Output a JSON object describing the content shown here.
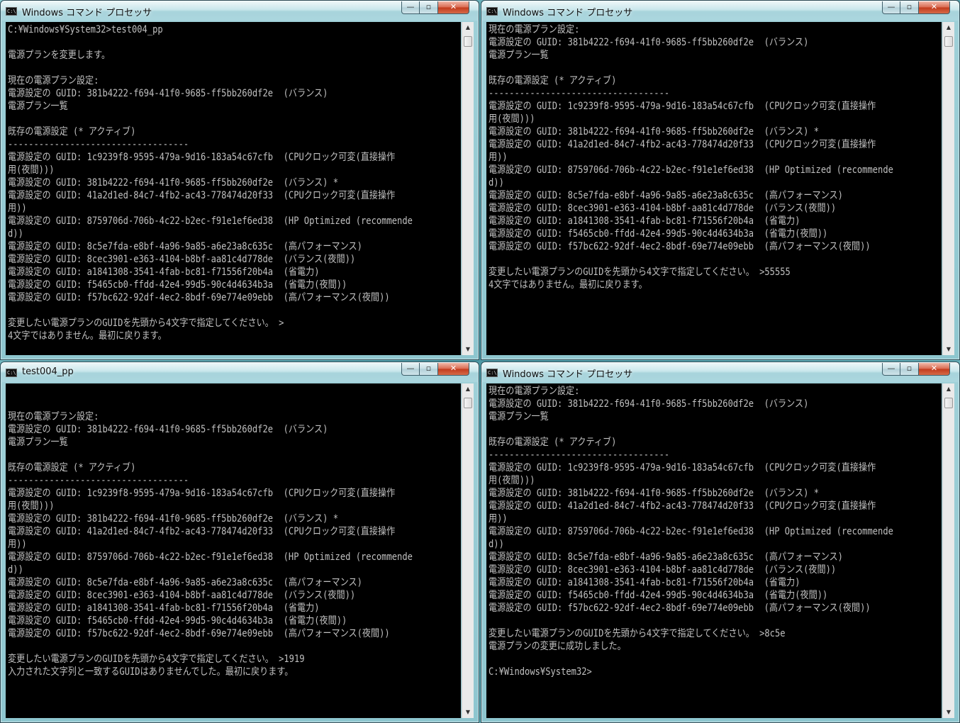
{
  "windows": [
    {
      "title": "Windows コマンド プロセッサ",
      "controls": {
        "minimize": "—",
        "maximize": "▫",
        "close": "✕"
      },
      "lines": [
        "C:¥Windows¥System32>test004_pp",
        "",
        "電源プランを変更します。",
        "",
        "現在の電源プラン設定:",
        "電源設定の GUID: 381b4222-f694-41f0-9685-ff5bb260df2e  (バランス)",
        "電源プラン一覧",
        "",
        "既存の電源設定 (* アクティブ)",
        "-----------------------------------",
        "電源設定の GUID: 1c9239f8-9595-479a-9d16-183a54c67cfb  (CPUクロック可変(直接操作",
        "用(夜間)))",
        "電源設定の GUID: 381b4222-f694-41f0-9685-ff5bb260df2e  (バランス) *",
        "電源設定の GUID: 41a2d1ed-84c7-4fb2-ac43-778474d20f33  (CPUクロック可変(直接操作",
        "用))",
        "電源設定の GUID: 8759706d-706b-4c22-b2ec-f91e1ef6ed38  (HP Optimized (recommende",
        "d))",
        "電源設定の GUID: 8c5e7fda-e8bf-4a96-9a85-a6e23a8c635c  (高パフォーマンス)",
        "電源設定の GUID: 8cec3901-e363-4104-b8bf-aa81c4d778de  (バランス(夜間))",
        "電源設定の GUID: a1841308-3541-4fab-bc81-f71556f20b4a  (省電力)",
        "電源設定の GUID: f5465cb0-ffdd-42e4-99d5-90c4d4634b3a  (省電力(夜間))",
        "電源設定の GUID: f57bc622-92df-4ec2-8bdf-69e774e09ebb  (高パフォーマンス(夜間))",
        "",
        "変更したい電源プランのGUIDを先頭から4文字で指定してください。 >",
        "4文字ではありません。最初に戻ります。"
      ]
    },
    {
      "title": "Windows コマンド プロセッサ",
      "controls": {
        "minimize": "—",
        "maximize": "▫",
        "close": "✕"
      },
      "lines": [
        "現在の電源プラン設定:",
        "電源設定の GUID: 381b4222-f694-41f0-9685-ff5bb260df2e  (バランス)",
        "電源プラン一覧",
        "",
        "既存の電源設定 (* アクティブ)",
        "-----------------------------------",
        "電源設定の GUID: 1c9239f8-9595-479a-9d16-183a54c67cfb  (CPUクロック可変(直接操作",
        "用(夜間)))",
        "電源設定の GUID: 381b4222-f694-41f0-9685-ff5bb260df2e  (バランス) *",
        "電源設定の GUID: 41a2d1ed-84c7-4fb2-ac43-778474d20f33  (CPUクロック可変(直接操作",
        "用))",
        "電源設定の GUID: 8759706d-706b-4c22-b2ec-f91e1ef6ed38  (HP Optimized (recommende",
        "d))",
        "電源設定の GUID: 8c5e7fda-e8bf-4a96-9a85-a6e23a8c635c  (高パフォーマンス)",
        "電源設定の GUID: 8cec3901-e363-4104-b8bf-aa81c4d778de  (バランス(夜間))",
        "電源設定の GUID: a1841308-3541-4fab-bc81-f71556f20b4a  (省電力)",
        "電源設定の GUID: f5465cb0-ffdd-42e4-99d5-90c4d4634b3a  (省電力(夜間))",
        "電源設定の GUID: f57bc622-92df-4ec2-8bdf-69e774e09ebb  (高パフォーマンス(夜間))",
        "",
        "変更したい電源プランのGUIDを先頭から4文字で指定してください。 >55555",
        "4文字ではありません。最初に戻ります。"
      ]
    },
    {
      "title": "test004_pp",
      "controls": {
        "minimize": "—",
        "maximize": "▫",
        "close": "✕"
      },
      "lines": [
        "",
        "",
        "現在の電源プラン設定:",
        "電源設定の GUID: 381b4222-f694-41f0-9685-ff5bb260df2e  (バランス)",
        "電源プラン一覧",
        "",
        "既存の電源設定 (* アクティブ)",
        "-----------------------------------",
        "電源設定の GUID: 1c9239f8-9595-479a-9d16-183a54c67cfb  (CPUクロック可変(直接操作",
        "用(夜間)))",
        "電源設定の GUID: 381b4222-f694-41f0-9685-ff5bb260df2e  (バランス) *",
        "電源設定の GUID: 41a2d1ed-84c7-4fb2-ac43-778474d20f33  (CPUクロック可変(直接操作",
        "用))",
        "電源設定の GUID: 8759706d-706b-4c22-b2ec-f91e1ef6ed38  (HP Optimized (recommende",
        "d))",
        "電源設定の GUID: 8c5e7fda-e8bf-4a96-9a85-a6e23a8c635c  (高パフォーマンス)",
        "電源設定の GUID: 8cec3901-e363-4104-b8bf-aa81c4d778de  (バランス(夜間))",
        "電源設定の GUID: a1841308-3541-4fab-bc81-f71556f20b4a  (省電力)",
        "電源設定の GUID: f5465cb0-ffdd-42e4-99d5-90c4d4634b3a  (省電力(夜間))",
        "電源設定の GUID: f57bc622-92df-4ec2-8bdf-69e774e09ebb  (高パフォーマンス(夜間))",
        "",
        "変更したい電源プランのGUIDを先頭から4文字で指定してください。 >1919",
        "入力された文字列と一致するGUIDはありませんでした。最初に戻ります。"
      ]
    },
    {
      "title": "Windows コマンド プロセッサ",
      "controls": {
        "minimize": "—",
        "maximize": "▫",
        "close": "✕"
      },
      "lines": [
        "現在の電源プラン設定:",
        "電源設定の GUID: 381b4222-f694-41f0-9685-ff5bb260df2e  (バランス)",
        "電源プラン一覧",
        "",
        "既存の電源設定 (* アクティブ)",
        "-----------------------------------",
        "電源設定の GUID: 1c9239f8-9595-479a-9d16-183a54c67cfb  (CPUクロック可変(直接操作",
        "用(夜間)))",
        "電源設定の GUID: 381b4222-f694-41f0-9685-ff5bb260df2e  (バランス) *",
        "電源設定の GUID: 41a2d1ed-84c7-4fb2-ac43-778474d20f33  (CPUクロック可変(直接操作",
        "用))",
        "電源設定の GUID: 8759706d-706b-4c22-b2ec-f91e1ef6ed38  (HP Optimized (recommende",
        "d))",
        "電源設定の GUID: 8c5e7fda-e8bf-4a96-9a85-a6e23a8c635c  (高パフォーマンス)",
        "電源設定の GUID: 8cec3901-e363-4104-b8bf-aa81c4d778de  (バランス(夜間))",
        "電源設定の GUID: a1841308-3541-4fab-bc81-f71556f20b4a  (省電力)",
        "電源設定の GUID: f5465cb0-ffdd-42e4-99d5-90c4d4634b3a  (省電力(夜間))",
        "電源設定の GUID: f57bc622-92df-4ec2-8bdf-69e774e09ebb  (高パフォーマンス(夜間))",
        "",
        "変更したい電源プランのGUIDを先頭から4文字で指定してください。 >8c5e",
        "電源プランの変更に成功しました。",
        "",
        "C:¥Windows¥System32>"
      ]
    }
  ],
  "theme": {
    "console_bg": "#000000",
    "console_fg": "#c0c0c0",
    "close_button": "#c23a1c"
  },
  "icons": {
    "title_icon": "cmd-console-icon",
    "scroll_up": "arrow-up-icon",
    "scroll_down": "arrow-down-icon"
  }
}
